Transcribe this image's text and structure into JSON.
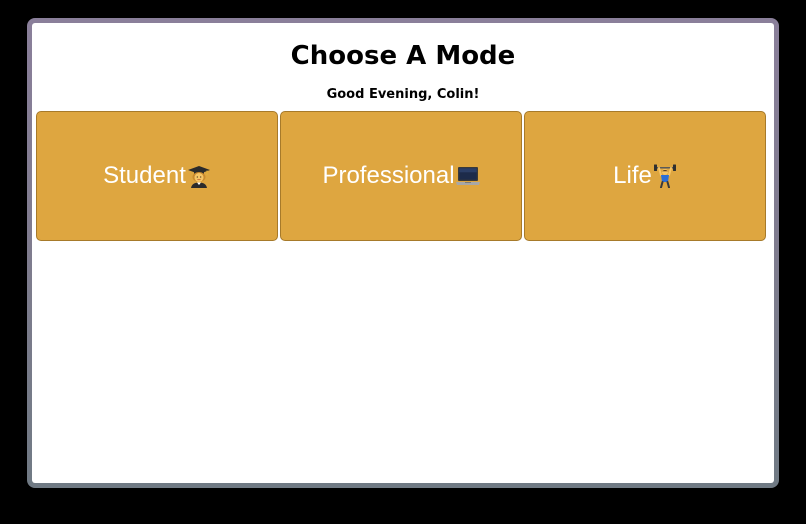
{
  "header": {
    "title": "Choose A Mode",
    "greeting": "Good Evening, Colin!"
  },
  "modes": [
    {
      "label": "Student",
      "icon": "student-graduate-icon"
    },
    {
      "label": "Professional",
      "icon": "laptop-icon"
    },
    {
      "label": "Life",
      "icon": "weightlifter-icon"
    }
  ],
  "colors": {
    "card_background": "#dea640",
    "card_border": "#a77a2a",
    "card_text": "#ffffff",
    "page_background": "#ffffff"
  }
}
